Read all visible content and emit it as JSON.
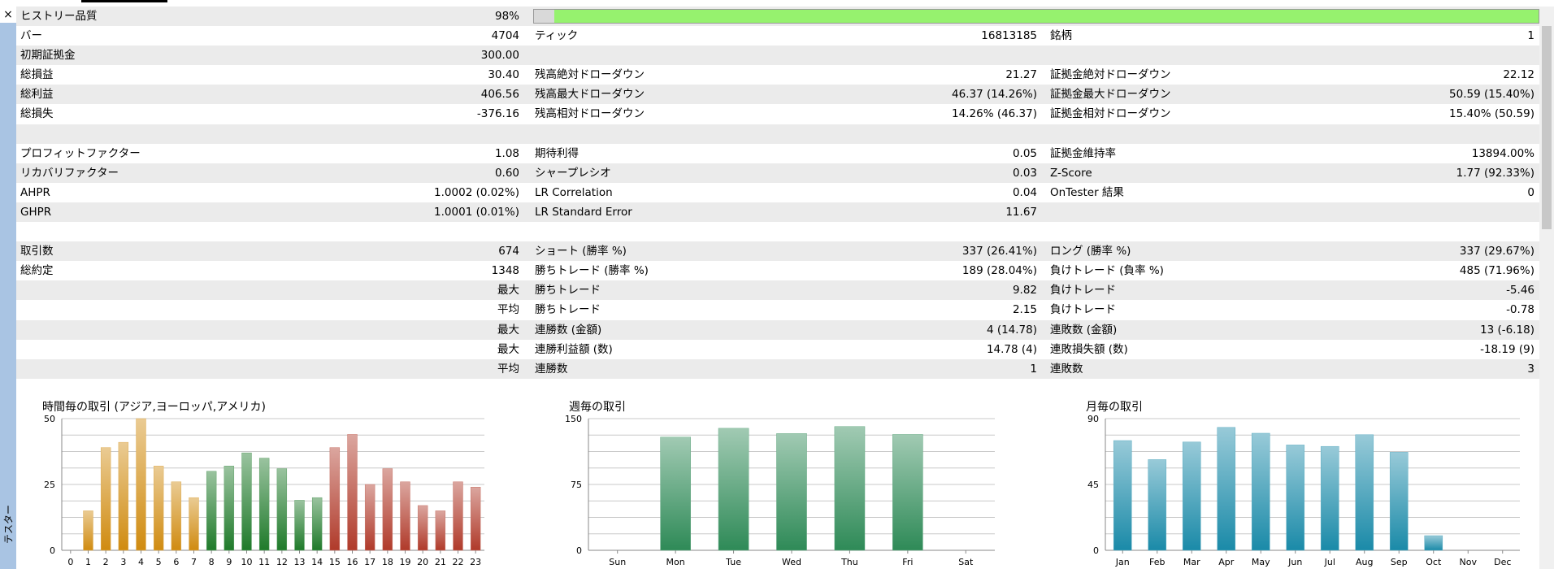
{
  "window": {
    "close_label": "×",
    "side_label": "テスター"
  },
  "rows": [
    {
      "c1": [
        "ヒストリー品質",
        "98%"
      ],
      "quality": 0.98
    },
    {
      "c1": [
        "バー",
        "4704"
      ],
      "c2": [
        "ティック",
        "16813185"
      ],
      "c3": [
        "銘柄",
        "1"
      ]
    },
    {
      "c1": [
        "初期証拠金",
        "300.00"
      ]
    },
    {
      "c1": [
        "総損益",
        "30.40"
      ],
      "c2": [
        "残高絶対ドローダウン",
        "21.27"
      ],
      "c3": [
        "証拠金絶対ドローダウン",
        "22.12"
      ]
    },
    {
      "c1": [
        "総利益",
        "406.56"
      ],
      "c2": [
        "残高最大ドローダウン",
        "46.37 (14.26%)"
      ],
      "c3": [
        "証拠金最大ドローダウン",
        "50.59 (15.40%)"
      ]
    },
    {
      "c1": [
        "総損失",
        "-376.16"
      ],
      "c2": [
        "残高相対ドローダウン",
        "14.26% (46.37)"
      ],
      "c3": [
        "証拠金相対ドローダウン",
        "15.40% (50.59)"
      ]
    },
    {},
    {
      "c1": [
        "プロフィットファクター",
        "1.08"
      ],
      "c2": [
        "期待利得",
        "0.05"
      ],
      "c3": [
        "証拠金維持率",
        "13894.00%"
      ]
    },
    {
      "c1": [
        "リカバリファクター",
        "0.60"
      ],
      "c2": [
        "シャープレシオ",
        "0.03"
      ],
      "c3": [
        "Z-Score",
        "1.77 (92.33%)"
      ]
    },
    {
      "c1": [
        "AHPR",
        "1.0002 (0.02%)"
      ],
      "c2": [
        "LR Correlation",
        "0.04"
      ],
      "c3": [
        "OnTester 結果",
        "0"
      ]
    },
    {
      "c1": [
        "GHPR",
        "1.0001 (0.01%)"
      ],
      "c2": [
        "LR Standard Error",
        "11.67"
      ]
    },
    {},
    {
      "c1": [
        "取引数",
        "674"
      ],
      "c2": [
        "ショート (勝率 %)",
        "337 (26.41%)"
      ],
      "c3": [
        "ロング (勝率 %)",
        "337 (29.67%)"
      ]
    },
    {
      "c1": [
        "総約定",
        "1348"
      ],
      "c2": [
        "勝ちトレード (勝率 %)",
        "189 (28.04%)"
      ],
      "c3": [
        "負けトレード (負率 %)",
        "485 (71.96%)"
      ]
    },
    {
      "c1": [
        "",
        "最大"
      ],
      "c2": [
        "勝ちトレード",
        "9.82"
      ],
      "c3": [
        "負けトレード",
        "-5.46"
      ]
    },
    {
      "c1": [
        "",
        "平均"
      ],
      "c2": [
        "勝ちトレード",
        "2.15"
      ],
      "c3": [
        "負けトレード",
        "-0.78"
      ]
    },
    {
      "c1": [
        "",
        "最大"
      ],
      "c2": [
        "連勝数 (金額)",
        "4 (14.78)"
      ],
      "c3": [
        "連敗数 (金額)",
        "13 (-6.18)"
      ]
    },
    {
      "c1": [
        "",
        "最大"
      ],
      "c2": [
        "連勝利益額 (数)",
        "14.78 (4)"
      ],
      "c3": [
        "連敗損失額 (数)",
        "-18.19 (9)"
      ]
    },
    {
      "c1": [
        "",
        "平均"
      ],
      "c2": [
        "連勝数",
        "1"
      ],
      "c3": [
        "連敗数",
        "3"
      ]
    },
    {}
  ],
  "colors": {
    "quality_fill": "#96f26e",
    "row_alt": "#ebebeb",
    "sidebar": "#a9c4e3"
  },
  "chart_data": [
    {
      "type": "bar",
      "title": "時間毎の取引 (アジア,ヨーロッパ,アメリカ)",
      "categories": [
        "0",
        "1",
        "2",
        "3",
        "4",
        "5",
        "6",
        "7",
        "8",
        "9",
        "10",
        "11",
        "12",
        "13",
        "14",
        "15",
        "16",
        "17",
        "18",
        "19",
        "20",
        "21",
        "22",
        "23"
      ],
      "values": [
        0,
        15,
        39,
        41,
        50,
        32,
        26,
        20,
        30,
        32,
        37,
        35,
        31,
        19,
        20,
        39,
        44,
        25,
        31,
        26,
        17,
        15,
        26,
        24
      ],
      "yticks": [
        "0",
        "25",
        "50"
      ],
      "ylim": [
        0,
        50
      ],
      "colors": [
        "#d08b10",
        "#d08b10",
        "#d08b10",
        "#d08b10",
        "#d08b10",
        "#d08b10",
        "#d08b10",
        "#d08b10",
        "#1f7a2a",
        "#1f7a2a",
        "#1f7a2a",
        "#1f7a2a",
        "#1f7a2a",
        "#1f7a2a",
        "#1f7a2a",
        "#b03a2a",
        "#b03a2a",
        "#b03a2a",
        "#b03a2a",
        "#b03a2a",
        "#b03a2a",
        "#b03a2a",
        "#b03a2a",
        "#b03a2a"
      ]
    },
    {
      "type": "bar",
      "title": "週毎の取引",
      "categories": [
        "Sun",
        "Mon",
        "Tue",
        "Wed",
        "Thu",
        "Fri",
        "Sat"
      ],
      "values": [
        0,
        129,
        139,
        133,
        141,
        132,
        0
      ],
      "yticks": [
        "0",
        "75",
        "150"
      ],
      "ylim": [
        0,
        150
      ],
      "color": "#2e8a57"
    },
    {
      "type": "bar",
      "title": "月毎の取引",
      "categories": [
        "Jan",
        "Feb",
        "Mar",
        "Apr",
        "May",
        "Jun",
        "Jul",
        "Aug",
        "Sep",
        "Oct",
        "Nov",
        "Dec"
      ],
      "values": [
        75,
        62,
        74,
        84,
        80,
        72,
        71,
        79,
        67,
        10,
        0,
        0
      ],
      "yticks": [
        "0",
        "45",
        "90"
      ],
      "ylim": [
        0,
        90
      ],
      "color": "#1a8aa8"
    }
  ]
}
